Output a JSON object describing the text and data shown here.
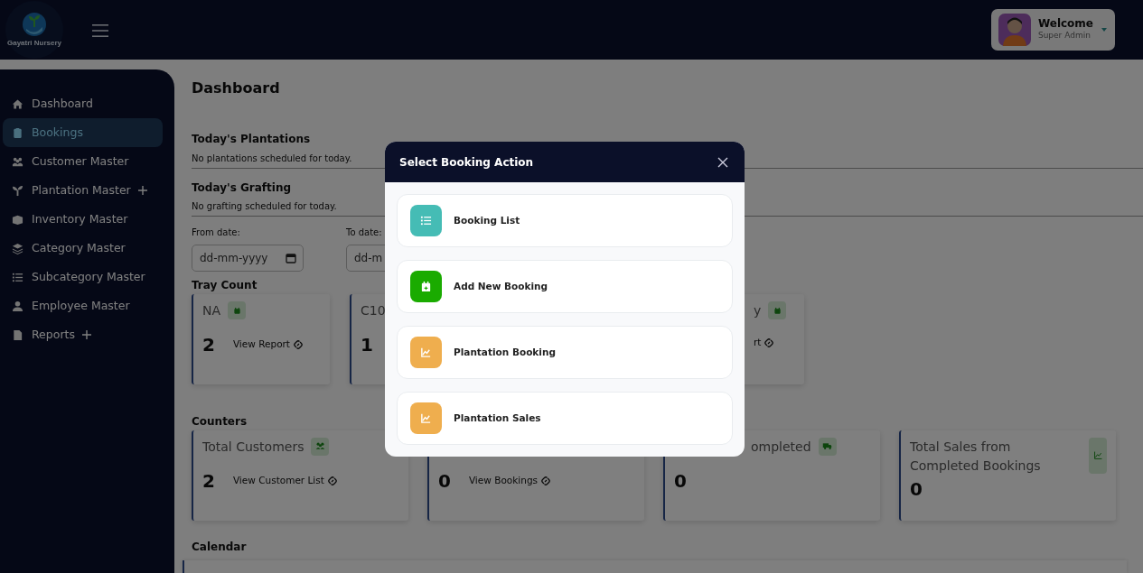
{
  "header": {
    "logo_text": "Gayatri Nursery",
    "user": {
      "greeting": "Welcome",
      "role": "Super Admin"
    }
  },
  "sidebar": {
    "items": [
      {
        "label": "Dashboard",
        "selected": false,
        "expandable": false
      },
      {
        "label": "Bookings",
        "selected": true,
        "expandable": false
      },
      {
        "label": "Customer Master",
        "selected": false,
        "expandable": false
      },
      {
        "label": "Plantation Master",
        "selected": false,
        "expandable": true
      },
      {
        "label": "Inventory Master",
        "selected": false,
        "expandable": false
      },
      {
        "label": "Category Master",
        "selected": false,
        "expandable": false
      },
      {
        "label": "Subcategory Master",
        "selected": false,
        "expandable": false
      },
      {
        "label": "Employee Master",
        "selected": false,
        "expandable": false
      },
      {
        "label": "Reports",
        "selected": false,
        "expandable": true
      }
    ]
  },
  "page": {
    "title": "Dashboard",
    "today": [
      {
        "title": "Today's Plantations",
        "message": "No plantations scheduled for today."
      },
      {
        "title": "Today's Grafting",
        "message": "No grafting scheduled for today."
      }
    ],
    "date_filters": [
      {
        "kind": "full",
        "label": "From date:",
        "placeholder": "dd-mm-yyyy"
      },
      {
        "kind": "cut",
        "label": "To date:",
        "placeholder": "dd-m"
      }
    ],
    "tray_count": {
      "title": "Tray Count",
      "cards": [
        {
          "kind": "full",
          "title": "NA",
          "count": "2",
          "link": "View Report"
        },
        {
          "kind": "cut-right",
          "title": "C10",
          "count": "1"
        },
        {
          "kind": "cut-left",
          "title": "y",
          "link": "rt"
        }
      ]
    },
    "counters": {
      "title": "Counters",
      "cards": [
        {
          "kind": "full",
          "title": "Total Customers",
          "count": "2",
          "link": "View Customer List"
        },
        {
          "kind": "cut-top",
          "count": "0",
          "link": "View Bookings"
        },
        {
          "kind": "cut-left",
          "title": "ompleted",
          "count": "0"
        },
        {
          "kind": "full",
          "title": "Total Sales from Completed Bookings",
          "count": "0"
        }
      ]
    },
    "calendar": {
      "title": "Calendar"
    }
  },
  "modal": {
    "title": "Select Booking Action",
    "items": [
      {
        "label": "Booking List",
        "color": "#45bcb5"
      },
      {
        "label": "Add New Booking",
        "color": "#1aab00"
      },
      {
        "label": "Plantation Booking",
        "color": "#efae4e"
      },
      {
        "label": "Plantation Sales",
        "color": "#efae4e"
      }
    ]
  }
}
